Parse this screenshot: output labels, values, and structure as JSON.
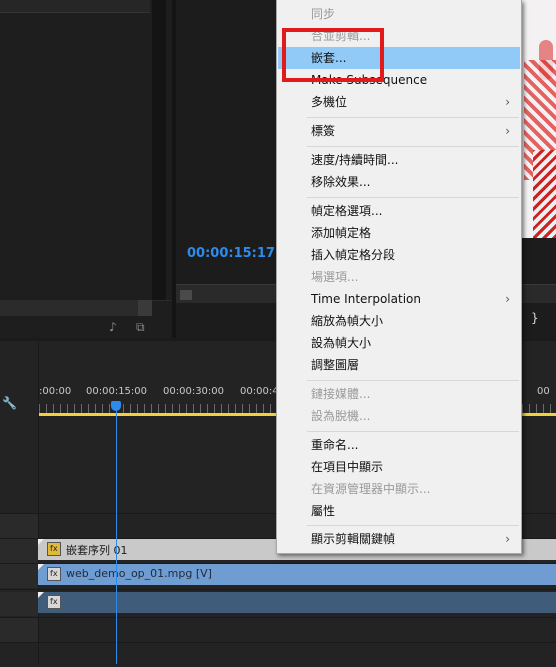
{
  "program_monitor": {
    "timecode": "00:00:15:17",
    "bracket": "}"
  },
  "project_panel": {
    "icons": [
      "audio-icon",
      "clip-icon"
    ]
  },
  "timeline": {
    "ruler_labels": [
      ":00:00",
      "00:00:15:00",
      "00:00:30:00",
      "00:00:4",
      "00"
    ],
    "clips": {
      "nested": {
        "fx": "fx",
        "label": "嵌套序列 01"
      },
      "video": {
        "fx": "fx",
        "label": "web_demo_op_01.mpg [V]"
      },
      "audio": {
        "fx": "fx"
      }
    }
  },
  "context_menu": {
    "items": [
      {
        "label": "同步",
        "enabled": false
      },
      {
        "label": "合並剪輯...",
        "enabled": false
      },
      {
        "label": "嵌套...",
        "enabled": true,
        "highlighted": true
      },
      {
        "label": "Make Subsequence",
        "enabled": true
      },
      {
        "label": "多機位",
        "enabled": true,
        "submenu": true
      },
      {
        "label": "標簽",
        "enabled": true,
        "submenu": true
      },
      {
        "label": "速度/持續時間...",
        "enabled": true
      },
      {
        "label": "移除效果...",
        "enabled": true
      },
      {
        "label": "幀定格選項...",
        "enabled": true
      },
      {
        "label": "添加幀定格",
        "enabled": true
      },
      {
        "label": "插入幀定格分段",
        "enabled": true
      },
      {
        "label": "場選項...",
        "enabled": false
      },
      {
        "label": "Time Interpolation",
        "enabled": true,
        "submenu": true
      },
      {
        "label": "縮放為幀大小",
        "enabled": true
      },
      {
        "label": "設為幀大小",
        "enabled": true
      },
      {
        "label": "調整圖層",
        "enabled": true
      },
      {
        "label": "鏈接媒體...",
        "enabled": false
      },
      {
        "label": "設為脫機...",
        "enabled": false
      },
      {
        "label": "重命名...",
        "enabled": true
      },
      {
        "label": "在項目中顯示",
        "enabled": true
      },
      {
        "label": "在資源管理器中顯示...",
        "enabled": false
      },
      {
        "label": "屬性",
        "enabled": true
      },
      {
        "label": "顯示剪輯關鍵幀",
        "enabled": true,
        "submenu": true
      }
    ],
    "submenu_arrow": "›"
  },
  "colors": {
    "timecode_blue": "#2d8ceb",
    "highlight": "#91c9f7",
    "annotation_red": "#e11b1b",
    "workarea_yellow": "#f3d13a",
    "video_clip": "#6f9cd1",
    "nested_clip": "#c9c9c9"
  }
}
